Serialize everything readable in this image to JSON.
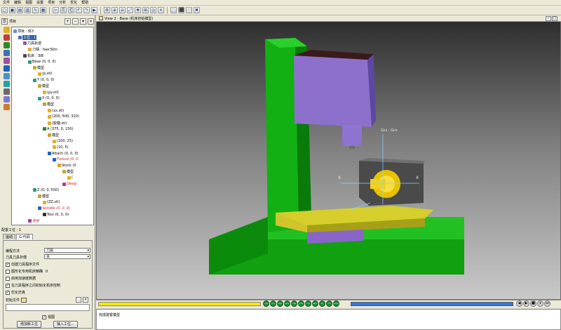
{
  "menu": [
    "文件",
    "编辑",
    "视图",
    "设置",
    "项目",
    "分析",
    "优化",
    "帮助"
  ],
  "left_panel": {
    "title": "项目",
    "tree": [
      {
        "label": "项目 : 体3",
        "depth": 0,
        "icon": "#6b8fc6"
      },
      {
        "label": "工位 : 1",
        "depth": 1,
        "icon": "#3c6fb8",
        "selected": true
      },
      {
        "label": "刀具轨迹",
        "depth": 2,
        "icon": "#a050a0"
      },
      {
        "label": "刀柄 : faer30m",
        "depth": 3,
        "icon": "#d8b030"
      },
      {
        "label": "机床 : 3IB",
        "depth": 2,
        "icon": "#4a4a4a"
      },
      {
        "label": "Base (0, 0, 0)",
        "depth": 3,
        "icon": "#2a9a8a"
      },
      {
        "label": "模型",
        "depth": 4,
        "icon": "#c8a030"
      },
      {
        "label": "(p.stl)",
        "depth": 5,
        "icon": "#e0b020"
      },
      {
        "label": "Y (0, 0, 0)",
        "depth": 4,
        "icon": "#2a9a8a"
      },
      {
        "label": "模型",
        "depth": 5,
        "icon": "#c8a030"
      },
      {
        "label": "(py.stl)",
        "depth": 6,
        "icon": "#e0b020"
      },
      {
        "label": "X (0, 0, 0)",
        "depth": 5,
        "icon": "#2a9a8a"
      },
      {
        "label": "模型",
        "depth": 6,
        "icon": "#c8a030"
      },
      {
        "label": "(xx.stl)",
        "depth": 7,
        "icon": "#e0b020"
      },
      {
        "label": "(200, 500, 320)",
        "depth": 7,
        "icon": "#e0b020"
      },
      {
        "label": "(胶箱.stl)",
        "depth": 7,
        "icon": "#e0b020"
      },
      {
        "label": "A (375, 0, 150)",
        "depth": 6,
        "icon": "#2a8a2a"
      },
      {
        "label": "模型",
        "depth": 7,
        "icon": "#c8a030"
      },
      {
        "label": "(100, 25)",
        "depth": 8,
        "icon": "#e0b020"
      },
      {
        "label": "(10, 5)",
        "depth": 8,
        "icon": "#e0b020"
      },
      {
        "label": "Attach (0, 0, 0)",
        "depth": 7,
        "icon": "#2060c0"
      },
      {
        "label": "Fixture (0, 0",
        "depth": 8,
        "icon": "#2060c0",
        "red": true
      },
      {
        "label": "Stock (0",
        "depth": 9,
        "icon": "#e0a020"
      },
      {
        "label": "模型",
        "depth": 10,
        "icon": "#c8a030"
      },
      {
        "label": "(",
        "depth": 11,
        "icon": "#e0b020"
      },
      {
        "label": "Desig",
        "depth": 10,
        "icon": "#a040a0",
        "red": true
      },
      {
        "label": "Z (0, 0, 550)",
        "depth": 4,
        "icon": "#2a9a8a"
      },
      {
        "label": "模型",
        "depth": 5,
        "icon": "#c8a030"
      },
      {
        "label": "(ZZ.stl)",
        "depth": 6,
        "icon": "#e0b020"
      },
      {
        "label": "Spindle (0, 0, 0)",
        "depth": 5,
        "icon": "#2060c0",
        "red": true
      },
      {
        "label": "Tool (0, 0, 0)",
        "depth": 6,
        "icon": "#303030"
      },
      {
        "label": "坐标",
        "depth": 3,
        "icon": "#a040a0",
        "red": true
      }
    ]
  },
  "settings": {
    "group_title": "配置工位 : 1",
    "tabs": [
      "运动",
      "G-代码"
    ],
    "active_tab": 1,
    "rows": [
      {
        "label": "编程方法",
        "value": "刀具"
      },
      {
        "label": "刀具刀具补偿",
        "value": "关"
      }
    ],
    "checkboxes": [
      {
        "label": "创建刀具程序文件",
        "checked": true
      },
      {
        "label": "图形化专用机床精确",
        "checked": false,
        "extra": "0"
      },
      {
        "label": "启用加速度数据",
        "checked": false
      },
      {
        "label": "在刀具程序之间初始化机床控制",
        "checked": true
      },
      {
        "label": "优化仿真",
        "checked": true
      }
    ],
    "file_label": "初始文件",
    "gcode_check": "视图",
    "add_button": "增加新工位",
    "import_button": "输入工位..."
  },
  "viewport": {
    "title": "View 2 - Base (机床初始模型)",
    "axis_label": "Gcs : Gcs"
  },
  "playback": {
    "machine_buttons": [
      "COMP",
      "TOOL",
      "TRACK",
      "MOVE",
      "COMP",
      "COMP",
      "CYCLE",
      "MACRO",
      "SEL",
      "OPTI",
      "MODEL"
    ],
    "controls": [
      "◀",
      "▶",
      "■",
      "⏸",
      "⏭"
    ]
  },
  "status": {
    "text": "完成建置模型"
  },
  "colors": {
    "machine_green": "#21b021",
    "spindle_purple": "#8a6cc8",
    "table_yellow": "#d8d028",
    "stock_yellow": "#e8c800",
    "fixture_dark": "#3a3a3a"
  }
}
